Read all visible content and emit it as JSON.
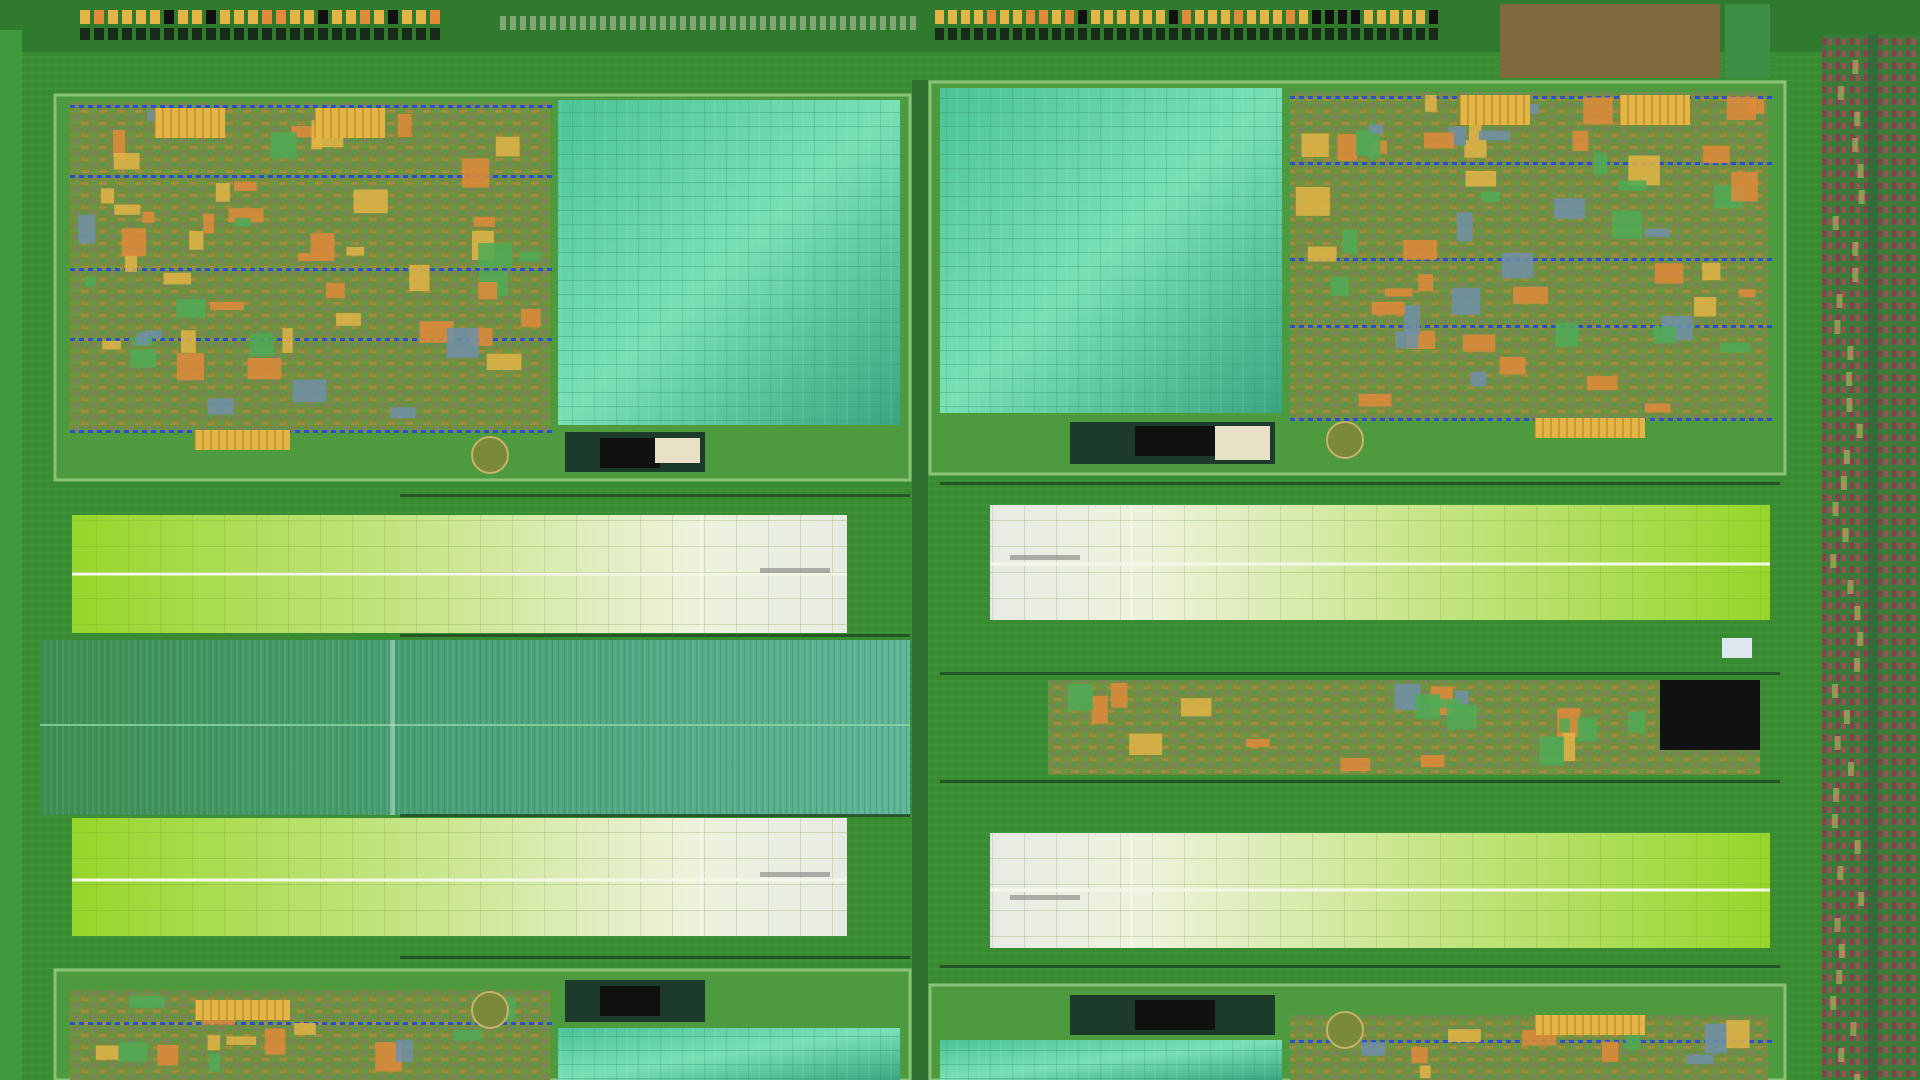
{
  "image": {
    "subject": "die-photo",
    "palette": {
      "substrate": "#3c8f35",
      "substrate_dark": "#2e7a2a",
      "trace_green": "#5cbf4a",
      "sram_teal": "#63d3a8",
      "sram_teal_dark": "#3fae8a",
      "cache_lime": "#9ad92a",
      "cache_pale": "#e4efc8",
      "cache_white": "#e9ece6",
      "logic_olive": "#7c8c3a",
      "logic_orange": "#e08a3a",
      "logic_gold": "#e3b446",
      "bus_blue": "#2a4fd0",
      "right_column_maroon": "#7a3a4a",
      "black": "#111111",
      "brown_pad": "#8c6a3c"
    }
  }
}
